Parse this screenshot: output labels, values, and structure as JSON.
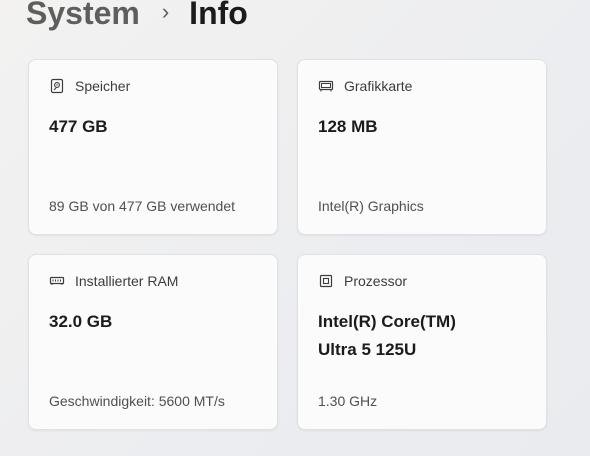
{
  "breadcrumb": {
    "parent": "System",
    "separator": "›",
    "current": "Info"
  },
  "cards": [
    {
      "icon": "storage-icon",
      "label": "Speicher",
      "value": "477 GB",
      "detail": "89 GB von 477 GB verwendet"
    },
    {
      "icon": "graphics-card-icon",
      "label": "Grafikkarte",
      "value": "128 MB",
      "detail": "Intel(R) Graphics"
    },
    {
      "icon": "ram-icon",
      "label": "Installierter RAM",
      "value": "32.0 GB",
      "detail": "Geschwindigkeit: 5600 MT/s"
    },
    {
      "icon": "processor-icon",
      "label": "Prozessor",
      "value_line1": "Intel(R) Core(TM)",
      "value_line2": "Ultra 5 125U",
      "detail": "1.30 GHz"
    }
  ]
}
